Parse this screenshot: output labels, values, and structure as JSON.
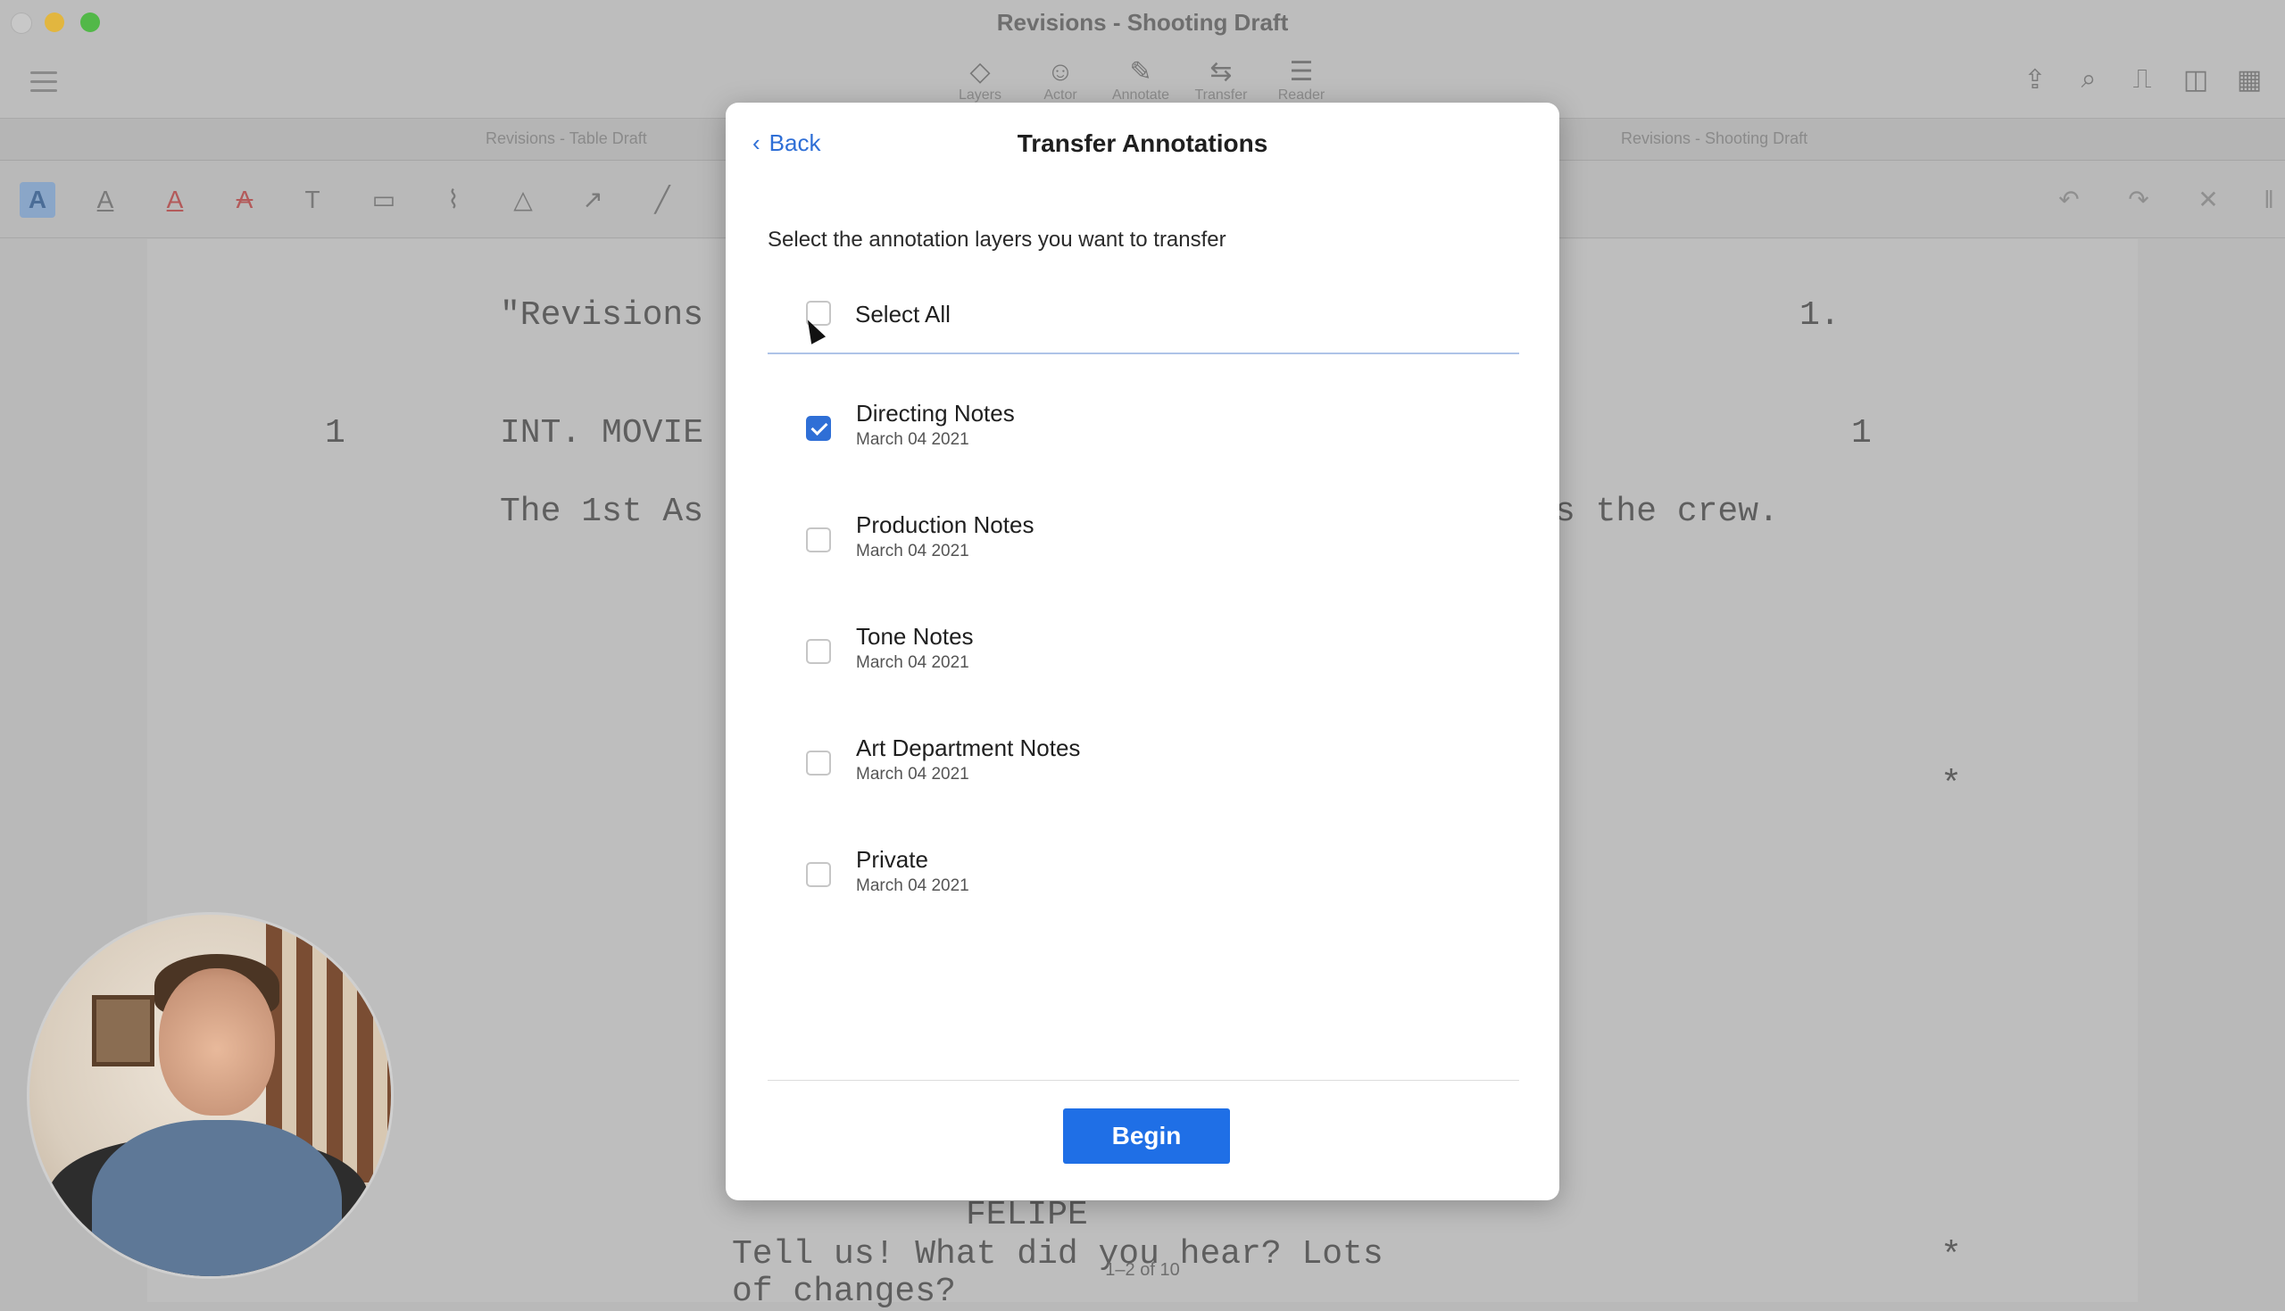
{
  "window": {
    "title": "Revisions - Shooting Draft"
  },
  "toolbar": {
    "modes": [
      {
        "label": "Layers",
        "icon": "layers-icon",
        "glyph": "◇"
      },
      {
        "label": "Actor",
        "icon": "actor-mask-icon",
        "glyph": "☺"
      },
      {
        "label": "Annotate",
        "icon": "pencil-icon",
        "glyph": "✎"
      },
      {
        "label": "Transfer",
        "icon": "transfer-icon",
        "glyph": "⇆"
      },
      {
        "label": "Reader",
        "icon": "reader-icon",
        "glyph": "☰"
      }
    ]
  },
  "tabs": {
    "left": "Revisions - Table Draft",
    "right": "Revisions - Shooting Draft"
  },
  "script": {
    "title_fragment": "\"Revisions",
    "page_number": "1.",
    "scene_number_left": "1",
    "scene_heading_fragment": "INT. MOVIE",
    "scene_number_right": "1",
    "action_left_fragment": "The 1st As",
    "action_right_fragment": "s the crew.",
    "asterisk_1": "*",
    "character": "FELIPE",
    "dialogue_line1": "Tell us!  What did you hear? Lots",
    "dialogue_line2": "of changes?",
    "asterisk_2": "*",
    "pager": "1–2 of 10"
  },
  "modal": {
    "back_label": "Back",
    "title": "Transfer Annotations",
    "instruction": "Select the annotation layers you want to transfer",
    "select_all_label": "Select All",
    "layers": [
      {
        "name": "Directing Notes",
        "date": "March 04 2021",
        "checked": true
      },
      {
        "name": "Production Notes",
        "date": "March 04 2021",
        "checked": false
      },
      {
        "name": "Tone Notes",
        "date": "March 04 2021",
        "checked": false
      },
      {
        "name": "Art Department Notes",
        "date": "March 04 2021",
        "checked": false
      },
      {
        "name": "Private",
        "date": "March 04 2021",
        "checked": false
      }
    ],
    "begin_label": "Begin"
  }
}
